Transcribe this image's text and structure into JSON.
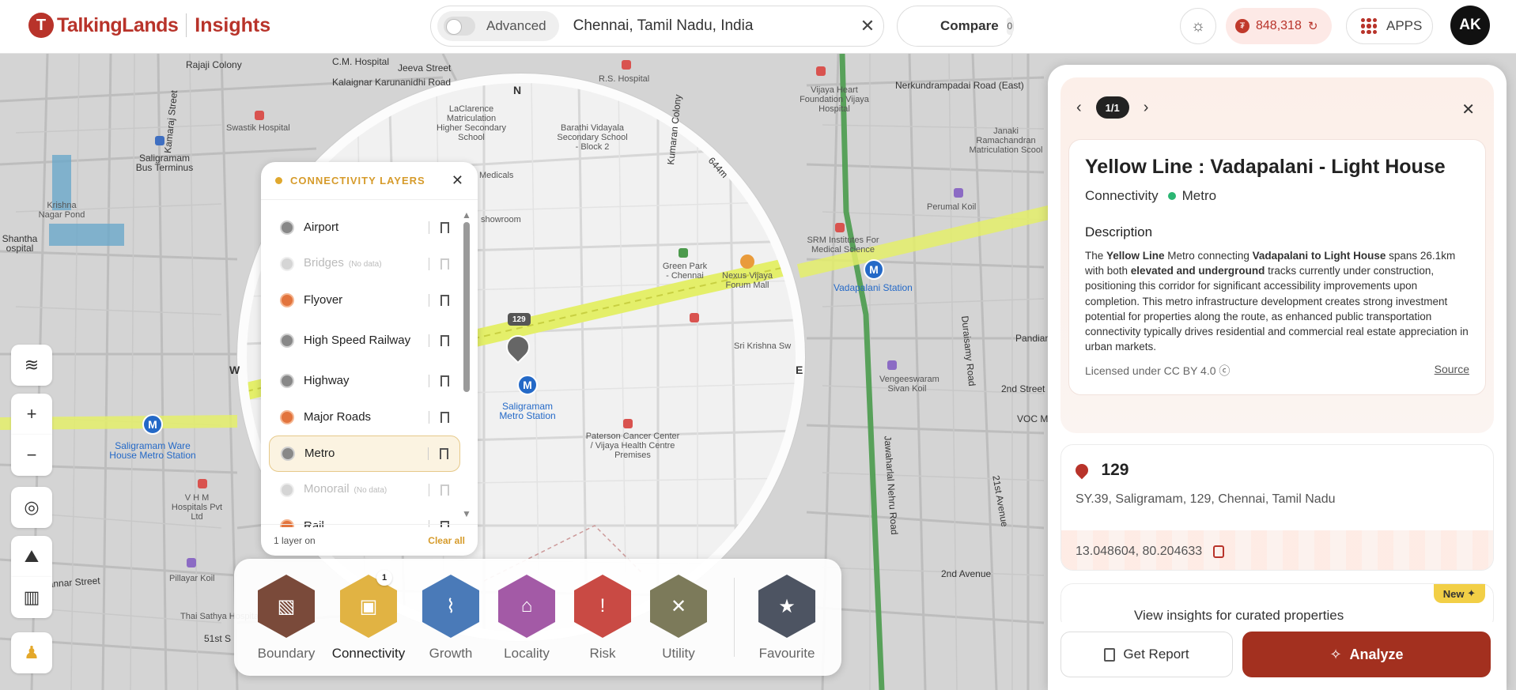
{
  "header": {
    "logo_name": "TalkingLands",
    "logo_product": "Insights",
    "advanced_label": "Advanced",
    "search_value": "Chennai, Tamil Nadu, India",
    "compare_label": "Compare",
    "compare_count": "0",
    "credits": "848,318",
    "apps_label": "APPS",
    "avatar_initials": "AK"
  },
  "map": {
    "labels": {
      "rajaji": "Rajaji Colony",
      "chm": "C.M. Hospital",
      "jeeva": "Jeeva Street",
      "kalaignar": "Kalaignar Karunanidhi Road",
      "rs": "R.S. Hospital",
      "swastik": "Swastik Hospital",
      "saligramam_bus": "Saligramam Bus Terminus",
      "krishna": "Krishna Nagar Pond",
      "shantha": "Shantha ospital",
      "vijaya_heart": "Vijaya Heart Foundation Vijaya Hospital",
      "nerkundram": "Nerkundrampadai Road (East)",
      "janaki": "Janaki Ramachandran Matriculation Scool",
      "perumal": "Perumal Koil",
      "srm": "SRM Institutes For Medical Science",
      "vadapalani": "Vadapalani Station",
      "saligramam_metro": "Saligramam Metro Station",
      "warehouse_metro": "Saligramam Ware House Metro Station",
      "paterson": "Paterson Cancer Center / Vijaya Health Centre Premises",
      "nexus": "Nexus Vijaya Forum Mall",
      "green_park": "Green Park - Chennai",
      "sri_krishna": "Sri Krishna Sw",
      "vhm": "V H M Hospitals Pvt Ltd",
      "pillayar": "Pillayar Koil",
      "thai": "Thai Sathya Hospital",
      "rajamannar": "Rajamannar Street",
      "street_51": "51st S",
      "street_2nd": "2nd Street",
      "street_21": "21st Avenue",
      "avenue_2nd": "2nd Avenue",
      "jawaharlal": "Jawaharlal Nehru Road",
      "kamaraj": "Kamaraj Street",
      "kumaran": "Kumaran Colony",
      "pandian": "Pandian",
      "voc": "VOC M",
      "durai": "Duraisamy Road",
      "vengeeswarar": "Vengeeswaram Sivan Koil",
      "barathi": "Barathi Vidayala Secondary School - Block 2",
      "laclarence": "LaClarence Matriculation Higher Secondary School",
      "medicals": "Medicals",
      "showroom": "showroom",
      "plot_label": "129"
    },
    "compass": {
      "n": "N",
      "e": "E",
      "w": "W",
      "radius": "644m"
    }
  },
  "layers_panel": {
    "title": "CONNECTIVITY LAYERS",
    "no_data": "(No data)",
    "items": [
      {
        "label": "Airport"
      },
      {
        "label": "Bridges"
      },
      {
        "label": "Flyover"
      },
      {
        "label": "High Speed Railway"
      },
      {
        "label": "Highway"
      },
      {
        "label": "Major Roads"
      },
      {
        "label": "Metro"
      },
      {
        "label": "Monorail"
      },
      {
        "label": "Rail"
      }
    ],
    "footer_count": "1 layer on",
    "clear_all": "Clear all"
  },
  "categories": {
    "items": [
      {
        "label": "Boundary",
        "color": "#7a4a3a"
      },
      {
        "label": "Connectivity",
        "color": "#e1b343"
      },
      {
        "label": "Growth",
        "color": "#4a7ab8"
      },
      {
        "label": "Locality",
        "color": "#a35aa6"
      },
      {
        "label": "Risk",
        "color": "#c94a44"
      },
      {
        "label": "Utility",
        "color": "#7c7a5a"
      },
      {
        "label": "Favourite",
        "color": "#4d5462"
      }
    ],
    "connectivity_badge": "1"
  },
  "details": {
    "pager": "1/1",
    "title": "Yellow Line : Vadapalani - Light House",
    "category": "Connectivity",
    "type": "Metro",
    "description_heading": "Description",
    "desc": {
      "p1": "The ",
      "b1": "Yellow Line",
      "p2": " Metro connecting ",
      "b2": "Vadapalani to Light House",
      "p3": " spans 26.1km with both ",
      "b3": "elevated and underground",
      "p4": " tracks currently under construction, positioning this corridor for significant accessibility improvements upon completion. This metro infrastructure development creates strong investment potential for properties along the route, as enhanced public transportation connectivity typically drives residential and commercial real estate appreciation in urban markets."
    },
    "license": "Licensed under CC BY 4.0",
    "source": "Source",
    "plot_number": "129",
    "address": "SY.39, Saligramam, 129, Chennai, Tamil Nadu",
    "coordinates": "13.048604, 80.204633",
    "new_badge": "New",
    "curated_text": "View insights for curated properties",
    "get_report": "Get Report",
    "analyze": "Analyze"
  },
  "colors": {
    "brand": "#b8332a",
    "accent": "#d69b2b",
    "metro_line": "#e4ef6a",
    "analyze": "#a3301f"
  }
}
